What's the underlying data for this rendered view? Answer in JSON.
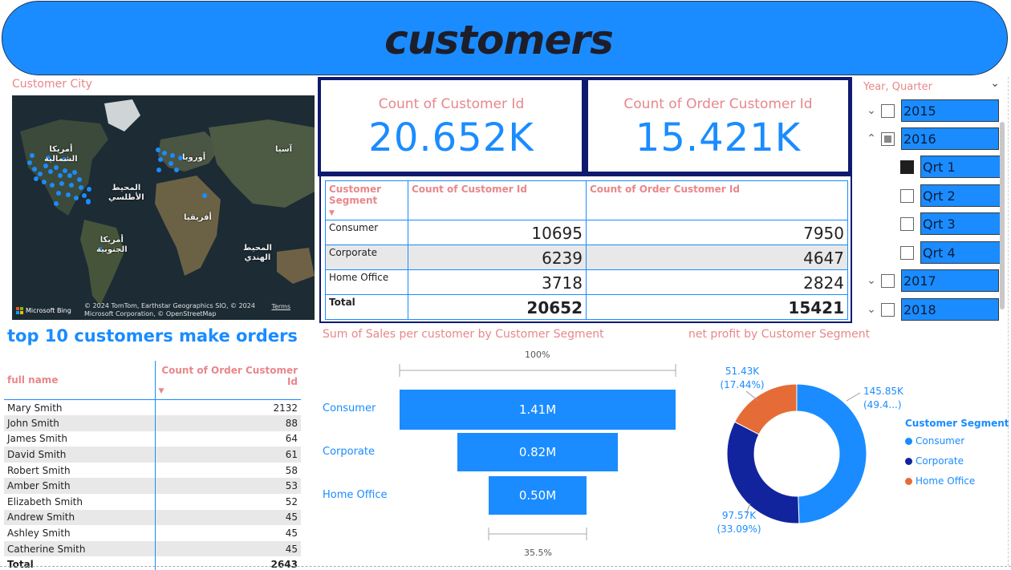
{
  "header": {
    "title": "customers"
  },
  "map": {
    "title": "Customer City",
    "labels": {
      "north_america": "أمريكا\nالشمالية",
      "europe": "أوروبا",
      "asia": "آسيا",
      "atlantic": "المحيط\nالأطلسي",
      "africa": "أفريقيا",
      "south_america": "أمريكا\nالجنوبية",
      "indian": "المحيط\nالهندي"
    },
    "attribution": "© 2024 TomTom, Earthstar Geographics SIO, © 2024 Microsoft Corporation, © OpenStreetMap",
    "terms": "Terms",
    "bing": "Microsoft Bing"
  },
  "kpis": [
    {
      "label": "Count of Customer Id",
      "value": "20.652K"
    },
    {
      "label": "Count of Order Customer Id",
      "value": "15.421K"
    }
  ],
  "segment_table": {
    "headers": [
      "Customer Segment",
      "Count of Customer Id",
      "Count of Order Customer Id"
    ],
    "rows": [
      {
        "segment": "Consumer",
        "customers": "10695",
        "orders": "7950"
      },
      {
        "segment": "Corporate",
        "customers": "6239",
        "orders": "4647"
      },
      {
        "segment": "Home Office",
        "customers": "3718",
        "orders": "2824"
      }
    ],
    "total": {
      "segment": "Total",
      "customers": "20652",
      "orders": "15421"
    }
  },
  "slicer": {
    "title": "Year, Quarter",
    "items": [
      {
        "label": "2015",
        "state": "unchecked",
        "chevron": "down"
      },
      {
        "label": "2016",
        "state": "partial",
        "chevron": "up"
      },
      {
        "label": "Qrt 1",
        "state": "checked"
      },
      {
        "label": "Qrt 2",
        "state": "unchecked"
      },
      {
        "label": "Qrt 3",
        "state": "unchecked"
      },
      {
        "label": "Qrt 4",
        "state": "unchecked"
      },
      {
        "label": "2017",
        "state": "unchecked",
        "chevron": "down"
      },
      {
        "label": "2018",
        "state": "unchecked",
        "chevron": "down"
      }
    ]
  },
  "top_customers": {
    "title": "top 10 customers make orders",
    "headers": [
      "full name",
      "Count of Order Customer Id"
    ],
    "rows": [
      {
        "name": "Mary Smith",
        "count": "2132"
      },
      {
        "name": "John Smith",
        "count": "88"
      },
      {
        "name": "James Smith",
        "count": "64"
      },
      {
        "name": "David Smith",
        "count": "61"
      },
      {
        "name": "Robert Smith",
        "count": "58"
      },
      {
        "name": "Amber Smith",
        "count": "53"
      },
      {
        "name": "Elizabeth Smith",
        "count": "52"
      },
      {
        "name": "Andrew Smith",
        "count": "45"
      },
      {
        "name": "Ashley Smith",
        "count": "45"
      },
      {
        "name": "Catherine Smith",
        "count": "45"
      }
    ],
    "total": {
      "name": "Total",
      "count": "2643"
    }
  },
  "chart_data": [
    {
      "type": "bar",
      "subtype": "funnel",
      "title": "Sum of Sales per customer by Customer Segment",
      "categories": [
        "Consumer",
        "Corporate",
        "Home Office"
      ],
      "values": [
        1.41,
        0.82,
        0.5
      ],
      "value_labels": [
        "1.41M",
        "0.82M",
        "0.50M"
      ],
      "top_pct_label": "100%",
      "bottom_pct_label": "35.5%",
      "color": "#1a8cff"
    },
    {
      "type": "pie",
      "subtype": "donut",
      "title": "net profit by Customer Segment",
      "legend_title": "Customer Segment",
      "legend_position": "right",
      "slices": [
        {
          "name": "Consumer",
          "value": 145.85,
          "label": "145.85K",
          "pct_label": "(49.4...)",
          "color": "#1a8cff"
        },
        {
          "name": "Corporate",
          "value": 97.57,
          "label": "97.57K",
          "pct_label": "(33.09%)",
          "color": "#12239e"
        },
        {
          "name": "Home Office",
          "value": 51.43,
          "label": "51.43K",
          "pct_label": "(17.44%)",
          "color": "#e66c37"
        }
      ]
    }
  ]
}
